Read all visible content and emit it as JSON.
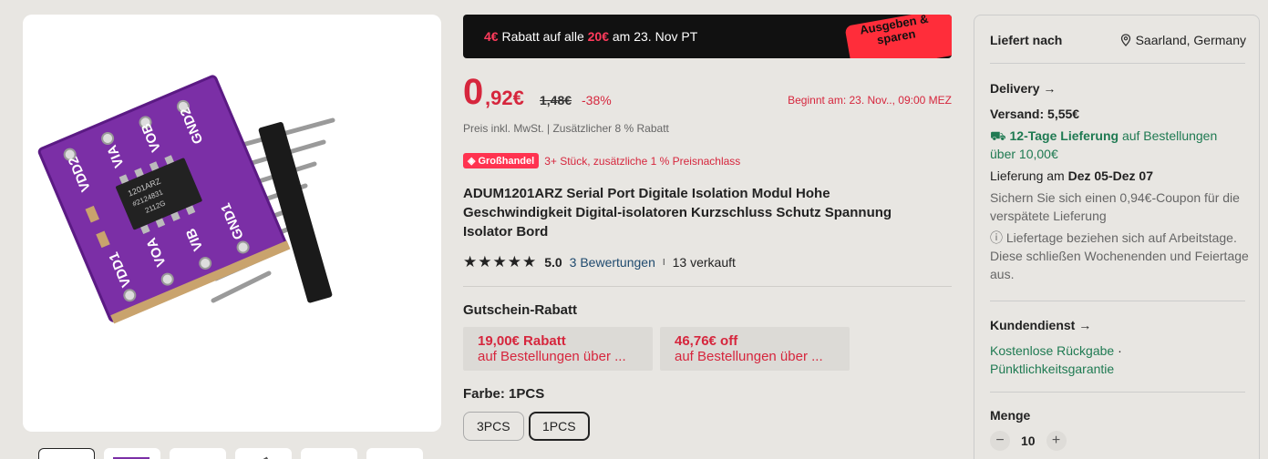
{
  "promo": {
    "text_part1": "4€",
    "text_part2": " Rabatt auf alle ",
    "text_part3": "20€",
    "text_part4": " am 23. Nov PT",
    "tag_line1": "Ausgeben &",
    "tag_line2": "sparen"
  },
  "price": {
    "integer": "0",
    "decimal": ",92€",
    "old": "1,48€",
    "discount": "-38%",
    "start": "Beginnt am: 23. Nov.., 09:00 MEZ"
  },
  "tax_note": "Preis inkl. MwSt. | Zusätzlicher 8 % Rabatt",
  "bulk": {
    "badge": "Großhandel",
    "text": "3+ Stück, zusätzliche 1 % Preisnachlass"
  },
  "product_title": "ADUM1201ARZ Serial Port Digitale Isolation Modul Hohe Geschwindigkeit Digital-isolatoren Kurzschluss Schutz Spannung Isolator Bord",
  "rating": {
    "stars": "★★★★★",
    "value": "5.0",
    "reviews": "3 Bewertungen",
    "sep": "I",
    "sold": "13 verkauft"
  },
  "coupons": {
    "label": "Gutschein-Rabatt",
    "items": [
      {
        "amount": "19,00€ Rabatt",
        "condition": "auf Bestellungen über ..."
      },
      {
        "amount": "46,76€ off",
        "condition": "auf Bestellungen über ..."
      }
    ]
  },
  "color": {
    "label": "Farbe: 1PCS",
    "options": [
      "3PCS",
      "1PCS"
    ],
    "selected": "1PCS"
  },
  "panel": {
    "ship_to": "Liefert nach",
    "location": "Saarland, Germany",
    "delivery_head": "Delivery",
    "shipping": "Versand: 5,55€",
    "fast_label": "12-Tage Lieferung",
    "fast_rest": " auf Bestellungen",
    "fast_line2": "über 10,00€",
    "delivery_prefix": "Lieferung am ",
    "delivery_dates": "Dez 05-Dez 07",
    "coupon_note": "Sichern Sie sich einen 0,94€-Coupon für die verspätete Lieferung",
    "workday_note": "Liefertage beziehen sich auf Arbeitstage. Diese schließen Wochenenden und Feiertage aus.",
    "service_head": "Kundendienst",
    "service_returns": "Kostenlose Rückgabe",
    "service_dot": " ·",
    "service_punctual": "Pünktlichkeitsgarantie",
    "qty_head": "Menge",
    "qty_minus": "−",
    "qty_value": "10",
    "qty_plus": "+"
  },
  "product_image": {
    "pcb_labels": [
      "VDD2",
      "VIA",
      "VOB",
      "GND2",
      "VDD1",
      "VOA",
      "VIB",
      "GND1"
    ],
    "chip_lines": [
      "1201ARZ",
      "#2124831",
      "2112G"
    ]
  },
  "colors": {
    "accent_red": "#d6263d",
    "promo_bg": "#111111",
    "tag_red": "#ff2d3a",
    "pcb_purple": "#7b2fa6",
    "green": "#1f7a52"
  }
}
